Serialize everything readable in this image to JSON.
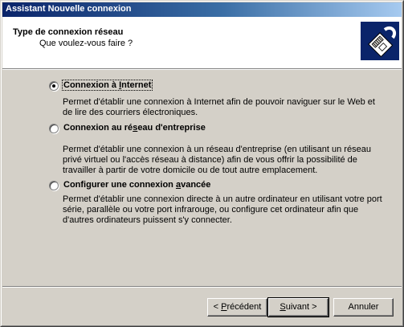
{
  "window": {
    "title": "Assistant Nouvelle connexion"
  },
  "header": {
    "title": "Type de connexion réseau",
    "subtitle": "Que voulez-vous faire ?",
    "icon": "network-cable-icon"
  },
  "options": [
    {
      "label_pre": "Connexion à ",
      "label_key": "I",
      "label_post": "nternet",
      "selected": true,
      "description": "Permet d'établir une connexion à Internet afin de pouvoir naviguer sur le Web et de lire des courriers électroniques."
    },
    {
      "label_pre": "Connexion au ré",
      "label_key": "s",
      "label_post": "eau d'entreprise",
      "selected": false,
      "description": "Permet d'établir une connexion à un réseau d'entreprise (en utilisant un réseau privé virtuel ou l'accès réseau à distance) afin de vous offrir la possibilité de travailler à partir de votre domicile ou de tout autre emplacement."
    },
    {
      "label_pre": "Configurer une connexion ",
      "label_key": "a",
      "label_post": "vancée",
      "selected": false,
      "description": "Permet d'établir une connexion directe à un autre ordinateur en utilisant votre port série, parallèle ou votre port infrarouge, ou configure cet ordinateur afin que d'autres ordinateurs puissent s'y connecter."
    }
  ],
  "buttons": {
    "back_pre": "< ",
    "back_key": "P",
    "back_post": "récédent",
    "next_key": "S",
    "next_post": "uivant >",
    "cancel": "Annuler"
  },
  "colors": {
    "title_gradient_start": "#0a246a",
    "title_gradient_end": "#a6caf0",
    "face": "#d4d0c8",
    "icon_bg": "#0a246a"
  }
}
